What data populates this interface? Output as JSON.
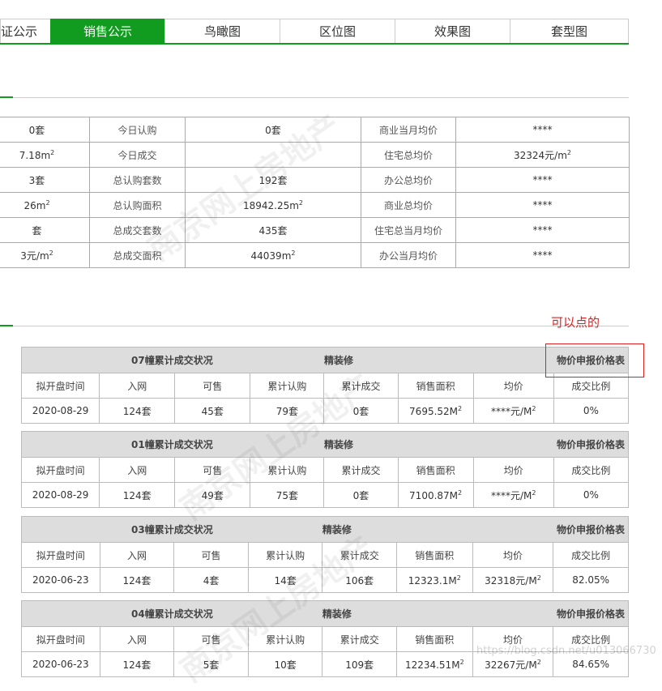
{
  "tabs": [
    {
      "label": "证公示",
      "active": false
    },
    {
      "label": "销售公示",
      "active": true
    },
    {
      "label": "鸟瞰图",
      "active": false
    },
    {
      "label": "区位图",
      "active": false
    },
    {
      "label": "效果图",
      "active": false
    },
    {
      "label": "套型图",
      "active": false
    }
  ],
  "summary": {
    "rows": [
      {
        "c0": "0套",
        "c0sup": "",
        "l1": "今日认购",
        "v1": "0套",
        "v1sup": "",
        "l2": "商业当月均价",
        "v2": "****",
        "v2sup": ""
      },
      {
        "c0": "7.18m",
        "c0sup": "2",
        "l1": "今日成交",
        "v1": "",
        "v1sup": "",
        "l2": "住宅总均价",
        "v2": "32324元/m",
        "v2sup": "2"
      },
      {
        "c0": "3套",
        "c0sup": "",
        "l1": "总认购套数",
        "v1": "192套",
        "v1sup": "",
        "l2": "办公总均价",
        "v2": "****",
        "v2sup": ""
      },
      {
        "c0": "26m",
        "c0sup": "2",
        "l1": "总认购面积",
        "v1": "18942.25m",
        "v1sup": "2",
        "l2": "商业总均价",
        "v2": "****",
        "v2sup": ""
      },
      {
        "c0": "套",
        "c0sup": "",
        "l1": "总成交套数",
        "v1": "435套",
        "v1sup": "",
        "l2": "住宅总当月均价",
        "v2": "****",
        "v2sup": ""
      },
      {
        "c0": "3元/m",
        "c0sup": "2",
        "l1": "总成交面积",
        "v1": "44039m",
        "v1sup": "2",
        "l2": "办公当月均价",
        "v2": "****",
        "v2sup": ""
      }
    ]
  },
  "annotation": "可以点的",
  "buildings": [
    {
      "title": "07幢累计成交状况",
      "decor": "精装修",
      "link": "物价申报价格表",
      "columns": [
        "拟开盘时间",
        "入网",
        "可售",
        "累计认购",
        "累计成交",
        "销售面积",
        "均价",
        "成交比例"
      ],
      "values": [
        "2020-08-29",
        "124套",
        "45套",
        "79套",
        "0套",
        "7695.52M",
        "****元/M",
        "0%"
      ],
      "sups": [
        "",
        "",
        "",
        "",
        "",
        "2",
        "2",
        ""
      ]
    },
    {
      "title": "01幢累计成交状况",
      "decor": "精装修",
      "link": "物价申报价格表",
      "columns": [
        "拟开盘时间",
        "入网",
        "可售",
        "累计认购",
        "累计成交",
        "销售面积",
        "均价",
        "成交比例"
      ],
      "values": [
        "2020-08-29",
        "124套",
        "49套",
        "75套",
        "0套",
        "7100.87M",
        "****元/M",
        "0%"
      ],
      "sups": [
        "",
        "",
        "",
        "",
        "",
        "2",
        "2",
        ""
      ]
    },
    {
      "title": "03幢累计成交状况",
      "decor": "精装修",
      "link": "物价申报价格表",
      "columns": [
        "拟开盘时间",
        "入网",
        "可售",
        "累计认购",
        "累计成交",
        "销售面积",
        "均价",
        "成交比例"
      ],
      "values": [
        "2020-06-23",
        "124套",
        "4套",
        "14套",
        "106套",
        "12323.1M",
        "32318元/M",
        "82.05%"
      ],
      "sups": [
        "",
        "",
        "",
        "",
        "",
        "2",
        "2",
        ""
      ]
    },
    {
      "title": "04幢累计成交状况",
      "decor": "精装修",
      "link": "物价申报价格表",
      "columns": [
        "拟开盘时间",
        "入网",
        "可售",
        "累计认购",
        "累计成交",
        "销售面积",
        "均价",
        "成交比例"
      ],
      "values": [
        "2020-06-23",
        "124套",
        "5套",
        "10套",
        "109套",
        "12234.51M",
        "32267元/M",
        "84.65%"
      ],
      "sups": [
        "",
        "",
        "",
        "",
        "",
        "2",
        "2",
        ""
      ]
    }
  ],
  "watermark": "南京网上房地产",
  "watermark_url": "NJHouse.com",
  "footer_watermark": "https://blog.csdn.net/u013066730",
  "colors": {
    "accent": "#119c1f",
    "link": "#2266cc",
    "annotation": "#e02020"
  }
}
